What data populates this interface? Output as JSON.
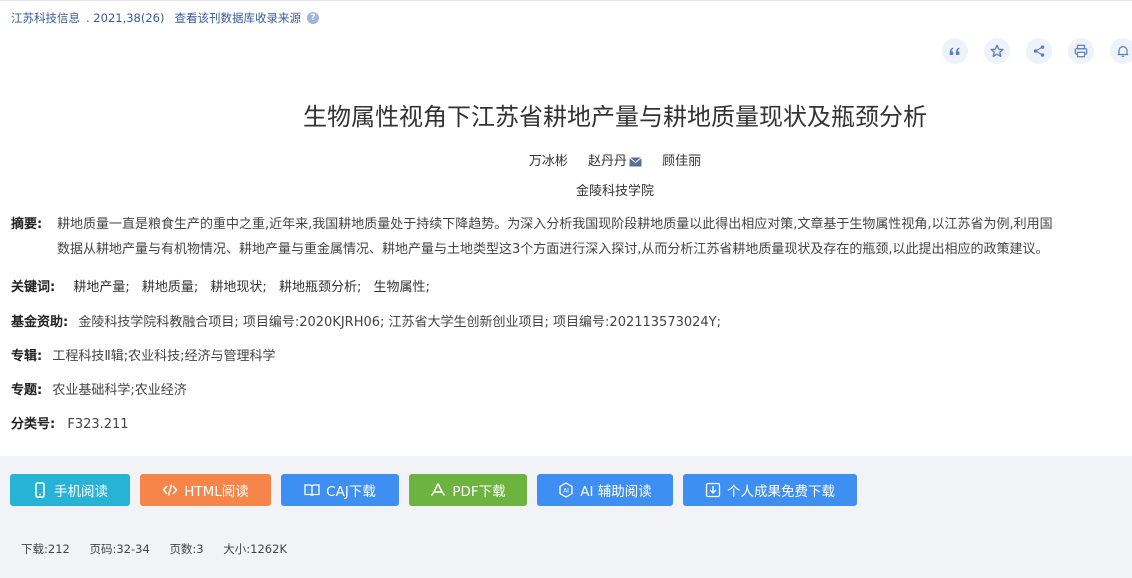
{
  "source": {
    "journal": "江苏科技信息",
    "issue": ". 2021,38(26)",
    "link": "查看该刊数据库收录来源"
  },
  "tools": [
    {
      "name": "cite-icon"
    },
    {
      "name": "favorite-icon"
    },
    {
      "name": "share-icon"
    },
    {
      "name": "print-icon"
    },
    {
      "name": "notify-icon"
    }
  ],
  "article": {
    "title": "生物属性视角下江苏省耕地产量与耕地质量现状及瓶颈分析",
    "authors": [
      "万冰彬",
      "赵丹丹",
      "顾佳丽"
    ],
    "organization": "金陵科技学院"
  },
  "abstract": {
    "label": "摘要:",
    "line1": "耕地质量一直是粮食生产的重中之重,近年来,我国耕地质量处于持续下降趋势。为深入分析我国现阶段耕地质量以此得出相应对策,文章基于生物属性视角,以江苏省为例,利用国",
    "line2": "数据从耕地产量与有机物情况、耕地产量与重金属情况、耕地产量与土地类型这3个方面进行深入探讨,从而分析江苏省耕地质量现状及存在的瓶颈,以此提出相应的政策建议。"
  },
  "keywords": {
    "label": "关键词:",
    "items": [
      "耕地产量;",
      "耕地质量;",
      "耕地现状;",
      "耕地瓶颈分析;",
      "生物属性;"
    ]
  },
  "funding": {
    "label": "基金资助:",
    "value": "金陵科技学院科教融合项目; 项目编号:2020KJRH06; 江苏省大学生创新创业项目; 项目编号:202113573024Y;"
  },
  "series": {
    "label": "专辑:",
    "value": "工程科技Ⅱ辑;农业科技;经济与管理科学"
  },
  "topic": {
    "label": "专题:",
    "value": "农业基础科学;农业经济"
  },
  "classification": {
    "label": "分类号:",
    "value": "F323.211"
  },
  "buttons": [
    {
      "label": "手机阅读",
      "icon": "phone-icon",
      "color": "#27b3d6"
    },
    {
      "label": "HTML阅读",
      "icon": "code-icon",
      "color": "#f6854a"
    },
    {
      "label": "CAJ下载",
      "icon": "book-icon",
      "color": "#3f8ff3"
    },
    {
      "label": "PDF下载",
      "icon": "pdf-icon",
      "color": "#6db33f"
    },
    {
      "label": "AI 辅助阅读",
      "icon": "ai-icon",
      "color": "#3f8ff3"
    },
    {
      "label": "个人成果免费下载",
      "icon": "download-icon",
      "color": "#3f8ff3"
    }
  ],
  "stats": {
    "downloads": "下载:212",
    "pages": "页码:32-34",
    "page_count": "页数:3",
    "size": "大小:1262K"
  }
}
